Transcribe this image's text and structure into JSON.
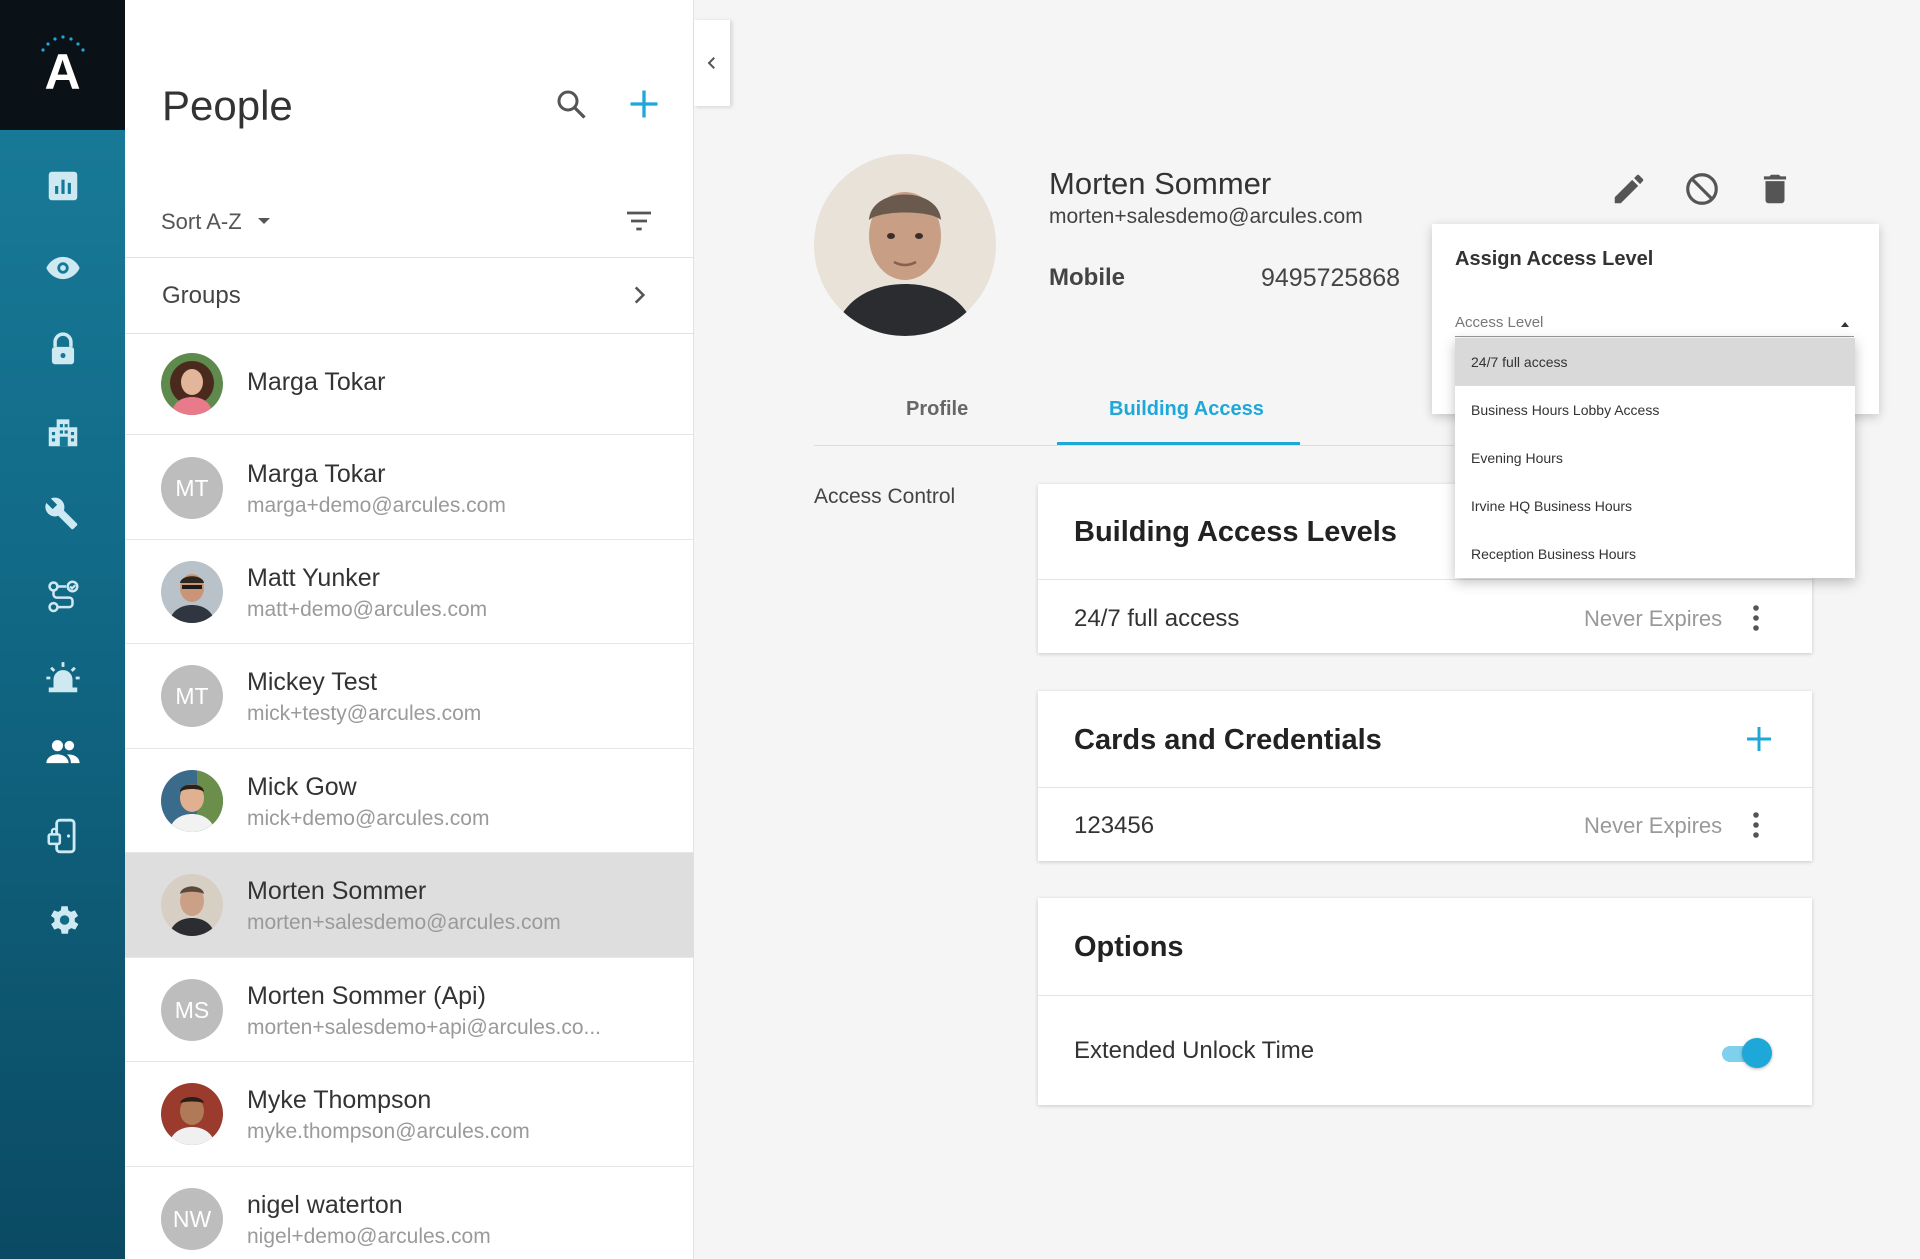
{
  "app": {
    "logo_letter": "A"
  },
  "rail": [
    "analytics-icon",
    "eye-icon",
    "lock-icon",
    "building-icon",
    "wrench-icon",
    "rules-icon",
    "alarm-icon",
    "people-icon",
    "door-icon",
    "gear-icon"
  ],
  "people_panel": {
    "title": "People",
    "sort_label": "Sort A-Z",
    "groups_label": "Groups",
    "people": [
      {
        "name": "Marga Tokar",
        "email": "",
        "avatar": "photo"
      },
      {
        "name": "Marga Tokar",
        "email": "marga+demo@arcules.com",
        "avatar": "MT"
      },
      {
        "name": "Matt Yunker",
        "email": "matt+demo@arcules.com",
        "avatar": "photo"
      },
      {
        "name": "Mickey Test",
        "email": "mick+testy@arcules.com",
        "avatar": "MT"
      },
      {
        "name": "Mick Gow",
        "email": "mick+demo@arcules.com",
        "avatar": "photo"
      },
      {
        "name": "Morten Sommer",
        "email": "morten+salesdemo@arcules.com",
        "avatar": "photo"
      },
      {
        "name": "Morten Sommer (Api)",
        "email": "morten+salesdemo+api@arcules.co...",
        "avatar": "MS"
      },
      {
        "name": "Myke Thompson",
        "email": "myke.thompson@arcules.com",
        "avatar": "photo"
      },
      {
        "name": "nigel waterton",
        "email": "nigel+demo@arcules.com",
        "avatar": "NW"
      }
    ]
  },
  "detail": {
    "name": "Morten Sommer",
    "email": "morten+salesdemo@arcules.com",
    "mobile_label": "Mobile",
    "mobile_value": "9495725868",
    "tabs": {
      "profile": "Profile",
      "building_access": "Building Access"
    },
    "access_control_label": "Access Control",
    "building_access": {
      "title": "Building Access Levels",
      "value": "24/7 full access",
      "expires": "Never Expires"
    },
    "cards": {
      "title": "Cards and Credentials",
      "value": "123456",
      "expires": "Never Expires"
    },
    "options": {
      "title": "Options",
      "extended_unlock_label": "Extended Unlock Time",
      "extended_unlock_on": true
    }
  },
  "assign_dialog": {
    "title": "Assign Access Level",
    "field_label": "Access Level",
    "options": [
      "24/7 full access",
      "Business Hours Lobby Access",
      "Evening Hours",
      "Irvine HQ Business Hours",
      "Reception Business Hours"
    ],
    "selected_index": 0
  },
  "colors": {
    "accent": "#1ea7d9",
    "rail_top": "#1a7e9c",
    "rail_bottom": "#0b4a63",
    "logo_bg": "#0b1217"
  }
}
